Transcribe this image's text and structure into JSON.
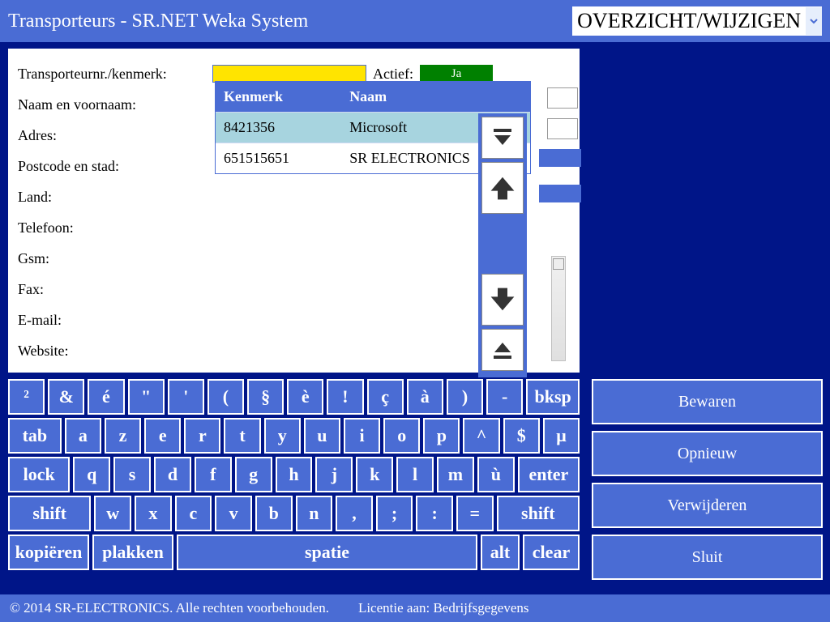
{
  "header": {
    "title": "Transporteurs - SR.NET Weka System",
    "mode": "OVERZICHT/WIJZIGEN"
  },
  "form": {
    "labels": {
      "transporteurnr": "Transporteurnr./kenmerk:",
      "naam": "Naam en voornaam:",
      "adres": "Adres:",
      "postcode": "Postcode en stad:",
      "land": "Land:",
      "telefoon": "Telefoon:",
      "gsm": "Gsm:",
      "fax": "Fax:",
      "email": "E-mail:",
      "website": "Website:",
      "actief": "Actief:"
    },
    "actief_value": "Ja"
  },
  "popup": {
    "headers": {
      "kenmerk": "Kenmerk",
      "naam": "Naam"
    },
    "rows": [
      {
        "kenmerk": "8421356",
        "naam": "Microsoft",
        "selected": true
      },
      {
        "kenmerk": "651515651",
        "naam": "SR ELECTRONICS",
        "selected": false
      }
    ]
  },
  "keyboard": {
    "r1": [
      "²",
      "&",
      "é",
      "\"",
      "'",
      "(",
      "§",
      "è",
      "!",
      "ç",
      "à",
      ")",
      "-",
      "bksp"
    ],
    "r2": [
      "tab",
      "a",
      "z",
      "e",
      "r",
      "t",
      "y",
      "u",
      "i",
      "o",
      "p",
      "^",
      "$",
      "µ"
    ],
    "r3": [
      "lock",
      "q",
      "s",
      "d",
      "f",
      "g",
      "h",
      "j",
      "k",
      "l",
      "m",
      "ù",
      "enter"
    ],
    "r4": [
      "shift",
      "w",
      "x",
      "c",
      "v",
      "b",
      "n",
      ",",
      ";",
      ":",
      "=",
      "shift"
    ],
    "r5": [
      "kopiëren",
      "plakken",
      "spatie",
      "alt",
      "clear"
    ]
  },
  "actions": {
    "bewaren": "Bewaren",
    "opnieuw": "Opnieuw",
    "verwijderen": "Verwijderen",
    "sluit": "Sluit"
  },
  "footer": {
    "copyright": "© 2014 SR-ELECTRONICS. Alle rechten voorbehouden.",
    "licentie": "Licentie aan: Bedrijfsgegevens"
  }
}
